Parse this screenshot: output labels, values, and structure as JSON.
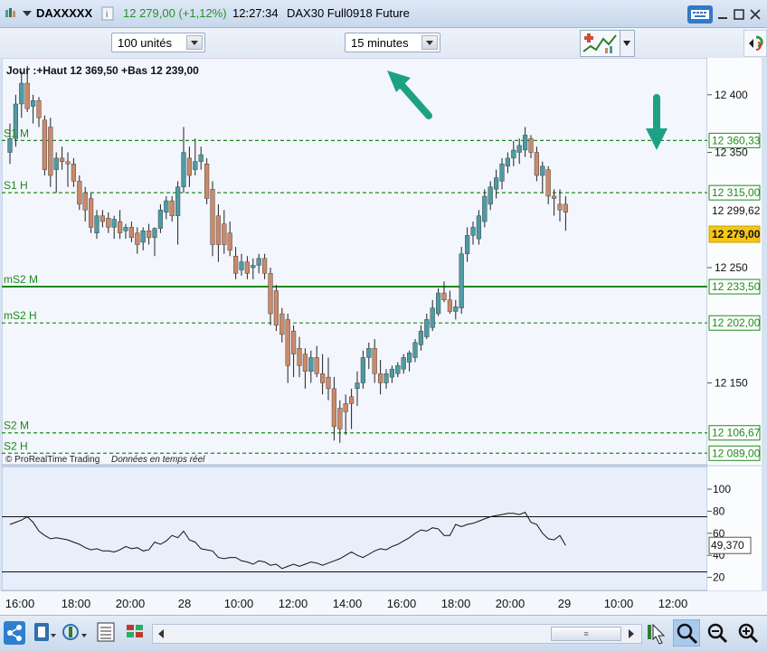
{
  "window": {
    "symbol": "DAXXXXX",
    "last_change": "12 279,00 (+1,12%)",
    "time": "12:27:34",
    "instrument": "DAX30 Full0918 Future"
  },
  "toolbar": {
    "units_select": "100 unités",
    "interval_select": "15 minutes"
  },
  "colors": {
    "up": "#4f9aa3",
    "down": "#c98a6b",
    "level": "#1c8a1c",
    "arrow": "#1da184",
    "last_price_bg": "#f5c518"
  },
  "chart_data": [
    {
      "type": "candlestick",
      "info_text": "Jour :+Haut 12 369,50 +Bas 12 239,00",
      "copyright": "© ProRealTime Trading",
      "realtime_note": "Données en temps réel",
      "ylim": [
        12079,
        12432
      ],
      "yticks": [
        12150,
        12250,
        12350,
        12400
      ],
      "ytick_labels": [
        "12 150",
        "12 250",
        "12 350",
        "12 400"
      ],
      "x_ticks": [
        "16:00",
        "18:00",
        "20:00",
        "28",
        "10:00",
        "12:00",
        "14:00",
        "16:00",
        "18:00",
        "20:00",
        "29",
        "10:00",
        "12:00"
      ],
      "current_price": {
        "value": 12299.62,
        "label": "12 299,62"
      },
      "last_price": {
        "value": 12279.0,
        "label": "12 279,00"
      },
      "levels": [
        {
          "name": "S1 M",
          "value": 12360.33,
          "label": "12 360,33",
          "style": "dashed"
        },
        {
          "name": "S1 H",
          "value": 12315.0,
          "label": "12 315,00",
          "style": "dashed"
        },
        {
          "name": "mS2 M",
          "value": 12233.5,
          "label": "12 233,50",
          "style": "solid"
        },
        {
          "name": "mS2 H",
          "value": 12202.0,
          "label": "12 202,00",
          "style": "dashed"
        },
        {
          "name": "S2 M",
          "value": 12106.67,
          "label": "12 106,67",
          "style": "dashed"
        },
        {
          "name": "S2 H",
          "value": 12089.0,
          "label": "12 089,00",
          "style": "dashed"
        }
      ],
      "ohlc": [
        [
          12350,
          12375,
          12340,
          12362
        ],
        [
          12362,
          12400,
          12355,
          12392
        ],
        [
          12392,
          12420,
          12380,
          12410
        ],
        [
          12410,
          12425,
          12385,
          12388
        ],
        [
          12390,
          12400,
          12375,
          12395
        ],
        [
          12395,
          12398,
          12372,
          12380
        ],
        [
          12378,
          12382,
          12330,
          12335
        ],
        [
          12372,
          12380,
          12320,
          12330
        ],
        [
          12335,
          12350,
          12315,
          12345
        ],
        [
          12345,
          12355,
          12335,
          12342
        ],
        [
          12342,
          12350,
          12320,
          12340
        ],
        [
          12340,
          12345,
          12320,
          12325
        ],
        [
          12325,
          12330,
          12300,
          12305
        ],
        [
          12315,
          12320,
          12290,
          12300
        ],
        [
          12310,
          12315,
          12280,
          12285
        ],
        [
          12280,
          12300,
          12275,
          12295
        ],
        [
          12295,
          12300,
          12285,
          12290
        ],
        [
          12293,
          12298,
          12280,
          12285
        ],
        [
          12285,
          12295,
          12275,
          12292
        ],
        [
          12290,
          12300,
          12275,
          12280
        ],
        [
          12282,
          12288,
          12275,
          12285
        ],
        [
          12285,
          12290,
          12272,
          12276
        ],
        [
          12280,
          12285,
          12262,
          12270
        ],
        [
          12272,
          12285,
          12265,
          12282
        ],
        [
          12282,
          12288,
          12270,
          12276
        ],
        [
          12276,
          12285,
          12260,
          12284
        ],
        [
          12284,
          12305,
          12280,
          12300
        ],
        [
          12298,
          12312,
          12292,
          12308
        ],
        [
          12308,
          12312,
          12290,
          12295
        ],
        [
          12295,
          12325,
          12270,
          12320
        ],
        [
          12320,
          12372,
          12315,
          12350
        ],
        [
          12345,
          12355,
          12320,
          12330
        ],
        [
          12335,
          12362,
          12330,
          12342
        ],
        [
          12342,
          12355,
          12335,
          12348
        ],
        [
          12340,
          12345,
          12305,
          12310
        ],
        [
          12318,
          12325,
          12260,
          12270
        ],
        [
          12295,
          12305,
          12255,
          12270
        ],
        [
          12288,
          12300,
          12262,
          12270
        ],
        [
          12280,
          12290,
          12260,
          12265
        ],
        [
          12260,
          12268,
          12240,
          12245
        ],
        [
          12248,
          12262,
          12243,
          12255
        ],
        [
          12255,
          12260,
          12240,
          12245
        ],
        [
          12250,
          12258,
          12240,
          12252
        ],
        [
          12252,
          12262,
          12245,
          12258
        ],
        [
          12258,
          12262,
          12240,
          12245
        ],
        [
          12245,
          12250,
          12200,
          12210
        ],
        [
          12230,
          12235,
          12195,
          12200
        ],
        [
          12210,
          12215,
          12185,
          12192
        ],
        [
          12205,
          12210,
          12150,
          12165
        ],
        [
          12195,
          12200,
          12155,
          12175
        ],
        [
          12180,
          12190,
          12155,
          12165
        ],
        [
          12175,
          12180,
          12145,
          12160
        ],
        [
          12160,
          12178,
          12150,
          12172
        ],
        [
          12172,
          12182,
          12155,
          12158
        ],
        [
          12158,
          12175,
          12140,
          12150
        ],
        [
          12155,
          12172,
          12135,
          12145
        ],
        [
          12145,
          12155,
          12100,
          12112
        ],
        [
          12128,
          12135,
          12098,
          12110
        ],
        [
          12132,
          12140,
          12105,
          12125
        ],
        [
          12138,
          12145,
          12110,
          12132
        ],
        [
          12145,
          12160,
          12130,
          12150
        ],
        [
          12150,
          12178,
          12145,
          12172
        ],
        [
          12172,
          12185,
          12162,
          12180
        ],
        [
          12180,
          12188,
          12150,
          12158
        ],
        [
          12158,
          12170,
          12140,
          12150
        ],
        [
          12150,
          12162,
          12145,
          12158
        ],
        [
          12155,
          12165,
          12150,
          12162
        ],
        [
          12158,
          12168,
          12155,
          12165
        ],
        [
          12162,
          12175,
          12158,
          12172
        ],
        [
          12168,
          12178,
          12160,
          12176
        ],
        [
          12172,
          12188,
          12168,
          12185
        ],
        [
          12183,
          12200,
          12178,
          12195
        ],
        [
          12190,
          12210,
          12188,
          12205
        ],
        [
          12198,
          12222,
          12195,
          12215
        ],
        [
          12210,
          12232,
          12208,
          12228
        ],
        [
          12228,
          12238,
          12220,
          12222
        ],
        [
          12222,
          12230,
          12210,
          12212
        ],
        [
          12212,
          12222,
          12205,
          12216
        ],
        [
          12215,
          12268,
          12210,
          12262
        ],
        [
          12262,
          12285,
          12255,
          12278
        ],
        [
          12278,
          12290,
          12270,
          12285
        ],
        [
          12275,
          12300,
          12270,
          12295
        ],
        [
          12290,
          12318,
          12285,
          12312
        ],
        [
          12305,
          12325,
          12300,
          12320
        ],
        [
          12318,
          12335,
          12310,
          12328
        ],
        [
          12325,
          12345,
          12318,
          12340
        ],
        [
          12338,
          12350,
          12332,
          12345
        ],
        [
          12345,
          12360,
          12338,
          12352
        ],
        [
          12350,
          12362,
          12340,
          12356
        ],
        [
          12352,
          12372,
          12346,
          12365
        ],
        [
          12362,
          12365,
          12345,
          12350
        ],
        [
          12350,
          12355,
          12325,
          12330
        ],
        [
          12330,
          12342,
          12315,
          12338
        ],
        [
          12335,
          12338,
          12305,
          12312
        ],
        [
          12312,
          12318,
          12295,
          12310
        ],
        [
          12305,
          12318,
          12290,
          12300
        ],
        [
          12305,
          12312,
          12282,
          12298
        ]
      ],
      "indicator": {
        "last_label": "49,370",
        "levels": [
          75,
          25
        ],
        "yticks": [
          20,
          40,
          60,
          80,
          100
        ],
        "values": [
          68,
          70,
          72,
          75,
          70,
          62,
          58,
          55,
          56,
          55,
          54,
          52,
          50,
          47,
          45,
          46,
          44,
          44,
          43,
          45,
          48,
          46,
          47,
          44,
          45,
          52,
          50,
          53,
          58,
          56,
          62,
          54,
          52,
          46,
          45,
          44,
          38,
          37,
          38,
          38,
          35,
          34,
          32,
          35,
          34,
          31,
          32,
          28,
          30,
          32,
          30,
          32,
          34,
          33,
          31,
          33,
          35,
          37,
          40,
          43,
          40,
          38,
          41,
          44,
          46,
          45,
          48,
          50,
          53,
          56,
          60,
          63,
          62,
          65,
          64,
          58,
          58,
          68,
          66,
          68,
          69,
          71,
          73,
          75,
          76,
          77,
          78,
          78,
          77,
          79,
          70,
          68,
          60,
          55,
          54,
          58,
          49
        ]
      }
    }
  ],
  "bottombar": {
    "scroll_label": "≡"
  }
}
